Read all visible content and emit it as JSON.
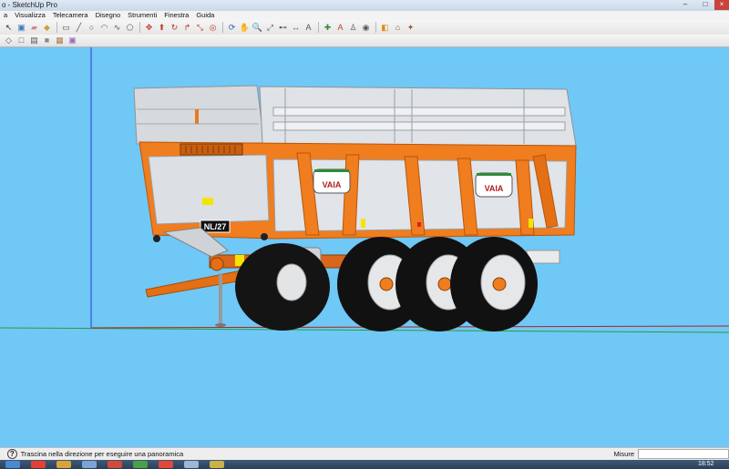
{
  "window": {
    "title": "o - SketchUp Pro",
    "controls": [
      "–",
      "□",
      "×"
    ]
  },
  "menubar": {
    "items": [
      "a",
      "Visualizza",
      "Telecamera",
      "Disegno",
      "Strumenti",
      "Finestra",
      "Guida"
    ]
  },
  "toolbar": {
    "row1": [
      {
        "name": "select-arrow-icon",
        "glyph": "↖",
        "color": "#333333"
      },
      {
        "name": "make-component-icon",
        "glyph": "▣",
        "color": "#3b7bbd"
      },
      {
        "name": "eraser-icon",
        "glyph": "▰",
        "color": "#d8848c"
      },
      {
        "name": "paint-bucket-icon",
        "glyph": "◆",
        "color": "#c9a23a"
      },
      {
        "name": "rectangle-icon",
        "glyph": "▭",
        "color": "#555555"
      },
      {
        "name": "line-icon",
        "glyph": "╱",
        "color": "#555555"
      },
      {
        "name": "circle-icon",
        "glyph": "○",
        "color": "#555555"
      },
      {
        "name": "arc-icon",
        "glyph": "◠",
        "color": "#555555"
      },
      {
        "name": "freehand-icon",
        "glyph": "∿",
        "color": "#555555"
      },
      {
        "name": "polygon-icon",
        "glyph": "⬠",
        "color": "#555555"
      },
      {
        "name": "move-icon",
        "glyph": "✥",
        "color": "#c0392b"
      },
      {
        "name": "push-pull-icon",
        "glyph": "⬆",
        "color": "#c0392b"
      },
      {
        "name": "rotate-icon",
        "glyph": "↻",
        "color": "#c0392b"
      },
      {
        "name": "follow-me-icon",
        "glyph": "↱",
        "color": "#c0392b"
      },
      {
        "name": "scale-icon",
        "glyph": "⤡",
        "color": "#c0392b"
      },
      {
        "name": "offset-icon",
        "glyph": "◎",
        "color": "#c0392b"
      },
      {
        "name": "orbit-icon",
        "glyph": "⟳",
        "color": "#2c5fa8"
      },
      {
        "name": "pan-icon",
        "glyph": "✋",
        "color": "#555555"
      },
      {
        "name": "zoom-icon",
        "glyph": "🔍",
        "color": "#555555"
      },
      {
        "name": "zoom-extents-icon",
        "glyph": "⤢",
        "color": "#555555"
      },
      {
        "name": "tape-measure-icon",
        "glyph": "⊷",
        "color": "#555555"
      },
      {
        "name": "dimension-icon",
        "glyph": "↔",
        "color": "#555555"
      },
      {
        "name": "text-icon",
        "glyph": "A",
        "color": "#555555"
      },
      {
        "name": "axes-icon",
        "glyph": "✚",
        "color": "#3a8a3a"
      },
      {
        "name": "3d-text-icon",
        "glyph": "A",
        "color": "#b04a2a"
      },
      {
        "name": "walk-icon",
        "glyph": "♙",
        "color": "#555555"
      },
      {
        "name": "look-around-icon",
        "glyph": "◉",
        "color": "#555555"
      },
      {
        "name": "section-plane-icon",
        "glyph": "◧",
        "color": "#e08a1e"
      },
      {
        "name": "3d-warehouse-icon",
        "glyph": "⌂",
        "color": "#a0522d"
      },
      {
        "name": "extension-warehouse-icon",
        "glyph": "✦",
        "color": "#a0522d"
      }
    ],
    "row2": [
      {
        "name": "xray-style-icon",
        "glyph": "◇",
        "color": "#555555"
      },
      {
        "name": "wireframe-style-icon",
        "glyph": "□",
        "color": "#555555"
      },
      {
        "name": "hidden-line-style-icon",
        "glyph": "▤",
        "color": "#555555"
      },
      {
        "name": "shaded-style-icon",
        "glyph": "■",
        "color": "#8a8a8a"
      },
      {
        "name": "textured-style-icon",
        "glyph": "▦",
        "color": "#b07a4a"
      },
      {
        "name": "monochrome-style-icon",
        "glyph": "▣",
        "color": "#9a6bb8"
      }
    ]
  },
  "model": {
    "brand_label": "VAIA",
    "plate_text": "NL/27"
  },
  "colors": {
    "sky": "#6fc8f6",
    "trailer_orange": "#f07d1e",
    "dark_orange": "#c95e10",
    "steel": "#d9dce0",
    "tire": "#111111"
  },
  "statusbar": {
    "help_icon": "?",
    "message": "Trascina nella direzione per eseguire una panoramica",
    "measure_label": "Misure",
    "measure_value": ""
  },
  "taskbar": {
    "apps": [
      {
        "name": "start-button",
        "color": "#4a8ad0"
      },
      {
        "name": "chrome-icon",
        "color": "#e34133"
      },
      {
        "name": "explorer-icon",
        "color": "#d9a43a"
      },
      {
        "name": "app-icon",
        "color": "#7aa3d6"
      },
      {
        "name": "app-icon",
        "color": "#d14a3a"
      },
      {
        "name": "app-icon",
        "color": "#49a048"
      },
      {
        "name": "sketchup-icon",
        "color": "#e0483a"
      },
      {
        "name": "app-icon",
        "color": "#9bb8d8"
      },
      {
        "name": "app-icon",
        "color": "#c9b24a"
      }
    ],
    "clock": "18:52"
  }
}
